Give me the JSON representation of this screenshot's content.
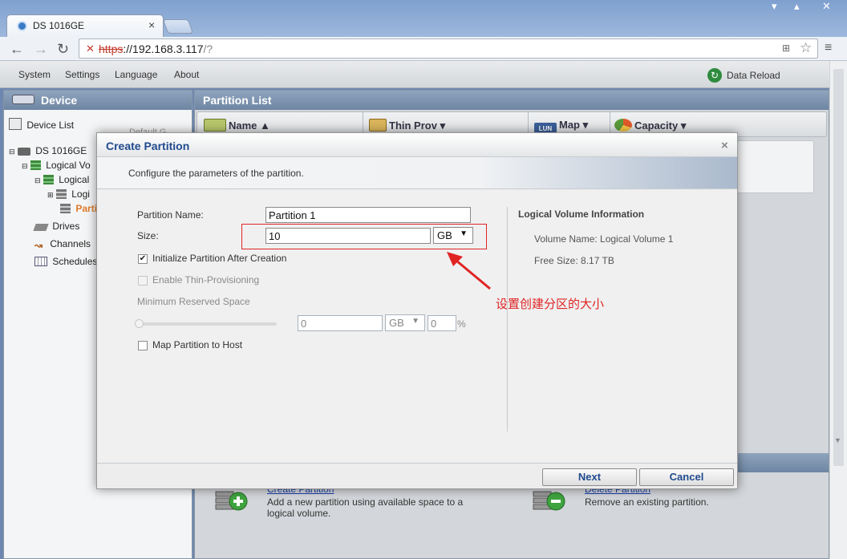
{
  "browser": {
    "tab_title": "DS 1016GE",
    "tab_close": "×",
    "url_scheme": "https",
    "url_host": "://192.168.3.117",
    "url_path": "/?"
  },
  "app": {
    "menu": [
      "System",
      "Settings",
      "Language",
      "About"
    ],
    "data_reload": "Data Reload"
  },
  "device_panel": {
    "header": "Device",
    "device_list": "Device List",
    "device_list_hint": "Default G...",
    "tree": {
      "device": "DS 1016GE",
      "logical_volumes": "Logical Vo",
      "logical_volume": "Logical",
      "logi": "Logi",
      "partitions": "Parti",
      "drives": "Drives",
      "channels": "Channels",
      "schedules": "Schedules"
    }
  },
  "partition_panel": {
    "header": "Partition List",
    "columns": [
      "Name",
      "Thin Prov",
      "Map",
      "Capacity"
    ],
    "map_badge": "LUN",
    "actions": {
      "create_link": "Create Partition",
      "create_desc": "Add a new partition using available space to a logical volume.",
      "delete_link": "Delete Partition",
      "delete_desc": "Remove an existing partition."
    }
  },
  "dialog": {
    "title": "Create Partition",
    "close": "×",
    "description": "Configure the parameters of the partition.",
    "partition_name_label": "Partition Name:",
    "partition_name_value": "Partition 1",
    "size_label": "Size:",
    "size_value": "10",
    "size_unit": "GB",
    "init_label": "Initialize Partition After Creation",
    "init_checked": true,
    "thin_label": "Enable Thin-Provisioning",
    "min_reserved_label": "Minimum Reserved Space",
    "reserved_value": "0",
    "reserved_unit": "GB",
    "reserved_percent": "0",
    "percent_sign": "%",
    "map_label": "Map Partition to Host",
    "info_title": "Logical Volume Information",
    "volume_name": "Volume Name: Logical Volume 1",
    "free_size": "Free Size: 8.17 TB",
    "next_button": "Next",
    "cancel_button": "Cancel"
  },
  "annotation": {
    "text": "设置创建分区的大小",
    "color": "#e02424"
  },
  "icons": {
    "tab": "globe-icon",
    "back": "arrow-left-icon",
    "forward": "arrow-right-icon",
    "reload": "reload-icon",
    "lock": "broken-lock-icon",
    "star": "star-icon",
    "menu": "hamburger-menu-icon"
  }
}
